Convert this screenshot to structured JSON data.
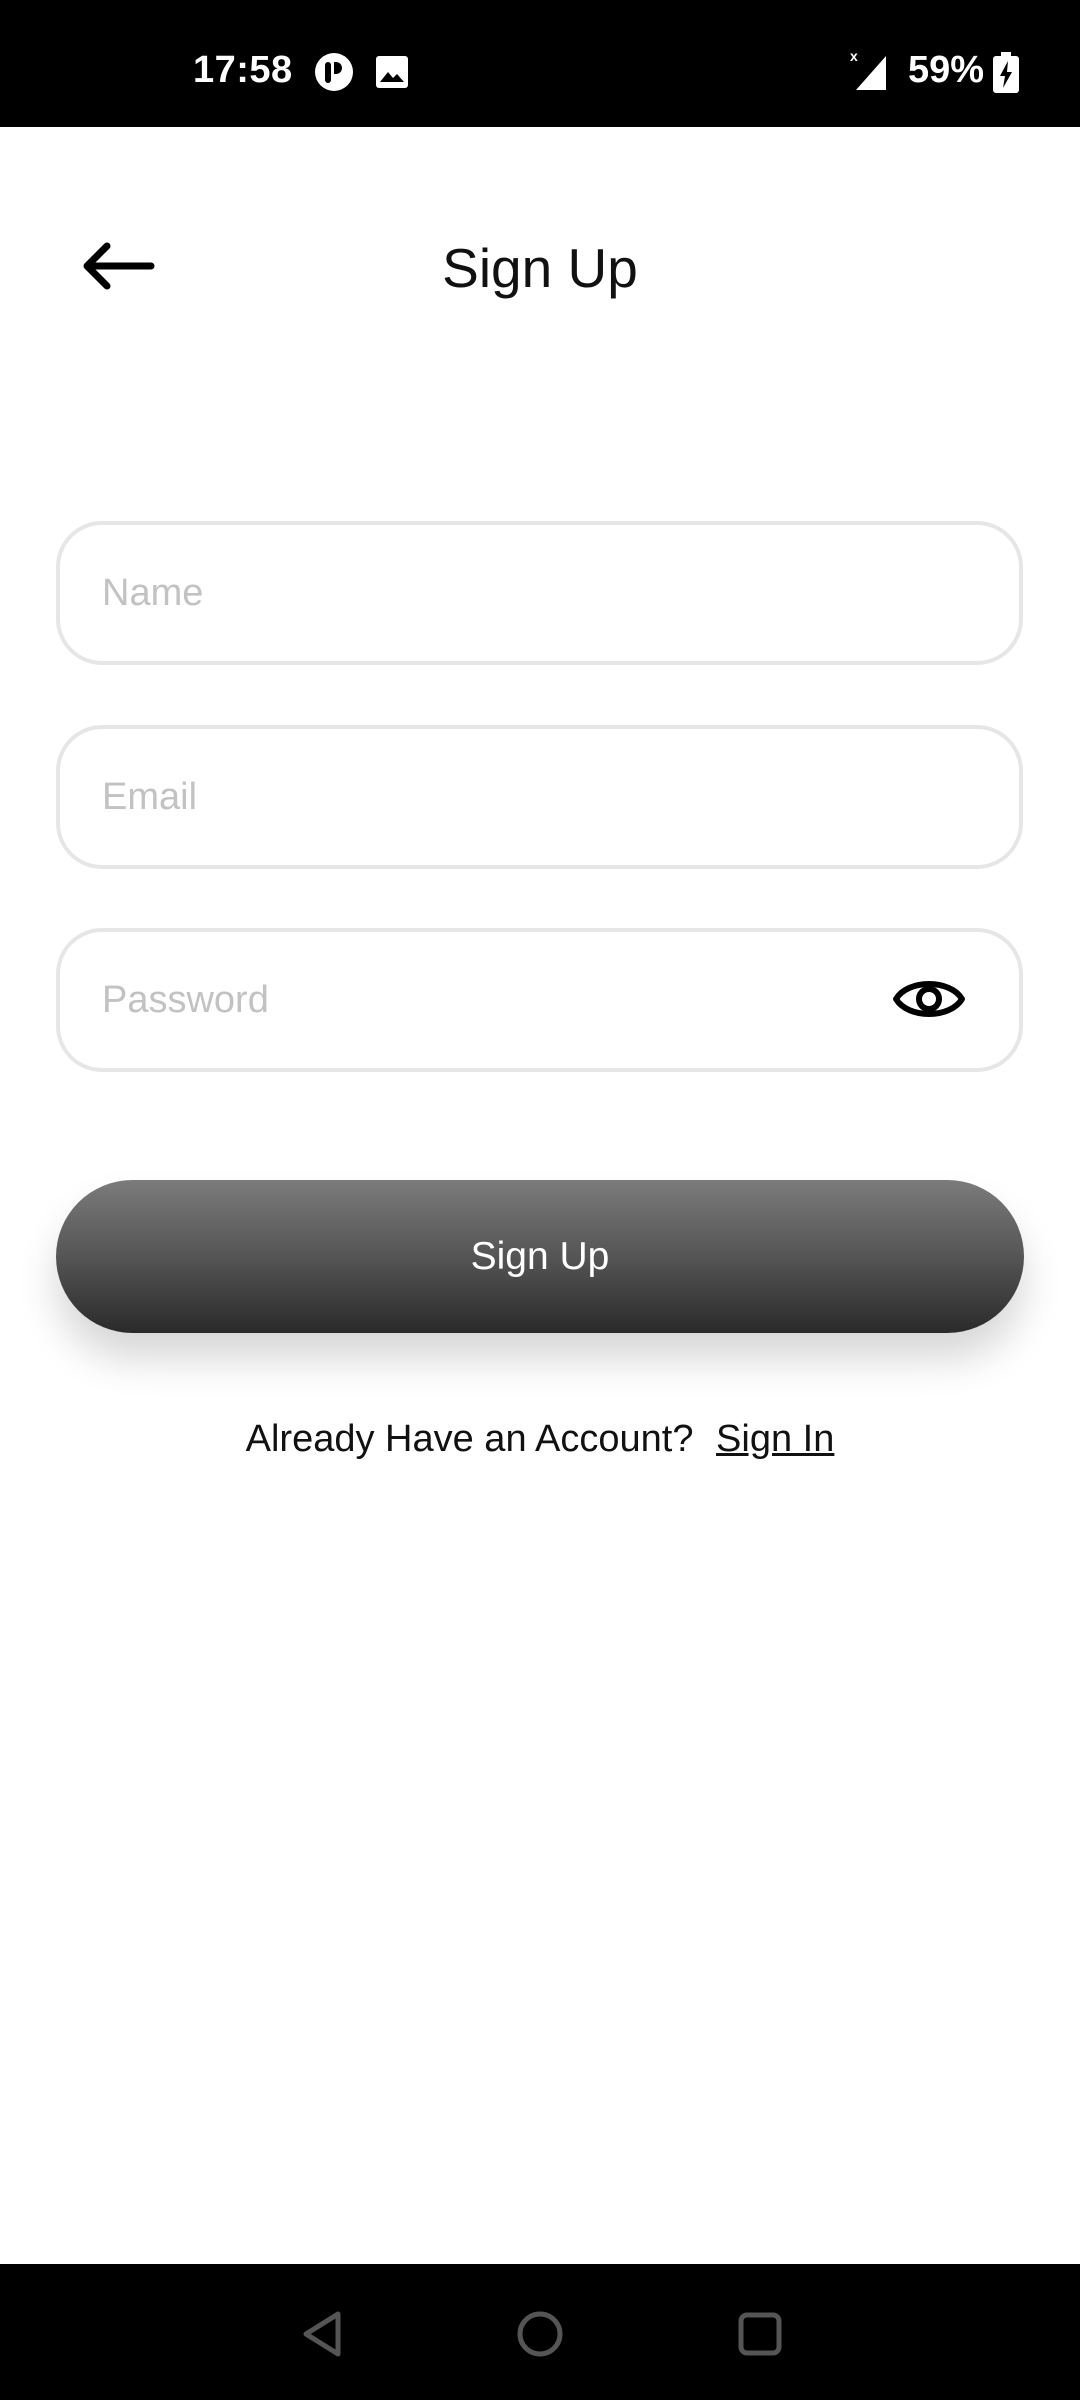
{
  "status_bar": {
    "time": "17:58",
    "battery_percent": "59%",
    "icons": [
      "notification-app-icon",
      "image-icon",
      "signal-icon",
      "battery-charging-icon"
    ]
  },
  "header": {
    "back_icon": "arrow-left-icon",
    "title": "Sign Up"
  },
  "form": {
    "name_placeholder": "Name",
    "email_placeholder": "Email",
    "password_placeholder": "Password",
    "name_value": "",
    "email_value": "",
    "password_value": "",
    "password_toggle_icon": "eye-icon"
  },
  "primary_button": {
    "label": "Sign Up"
  },
  "footer": {
    "prompt": "Already Have an Account?",
    "link_label": "Sign In"
  },
  "navigation_bar": {
    "icons": [
      "back-triangle-icon",
      "home-circle-icon",
      "recents-square-icon"
    ]
  },
  "colors": {
    "status_bar_bg": "#000000",
    "field_border": "#e6e6e6",
    "placeholder": "#c2c2c2",
    "button_gradient_top": "#7b7b7b",
    "button_gradient_bottom": "#2a2a2a",
    "text": "#111111"
  }
}
